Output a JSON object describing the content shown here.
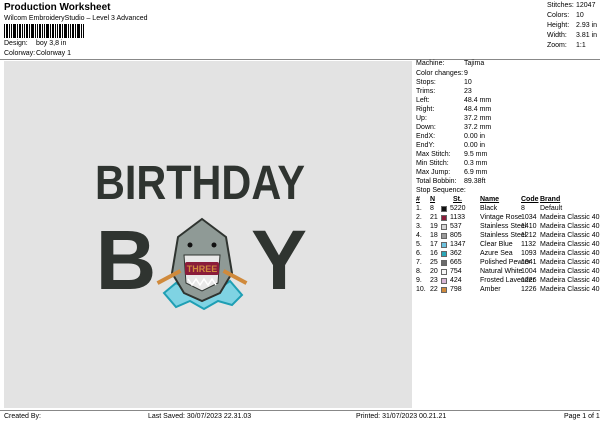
{
  "header": {
    "title": "Production Worksheet",
    "subtitle": "Wilcom EmbroideryStudio – Level 3 Advanced",
    "design_label": "Design:",
    "design_value": "boy 3,8 in",
    "colorway_label": "Colorway:",
    "colorway_value": "Colorway 1"
  },
  "header_stats": [
    {
      "label": "Stitches:",
      "value": "12047"
    },
    {
      "label": "Colors:",
      "value": "10"
    },
    {
      "label": "Height:",
      "value": "2.93 in"
    },
    {
      "label": "Width:",
      "value": "3.81 in"
    },
    {
      "label": "Zoom:",
      "value": "1:1"
    }
  ],
  "design": {
    "line1": "BIRTHDAY",
    "line2_left": "B",
    "line2_right": "Y",
    "three_text": "THREE"
  },
  "machine_info": [
    {
      "label": "Machine:",
      "value": "Tajima"
    },
    {
      "label": "Color changes:",
      "value": "9"
    },
    {
      "label": "Stops:",
      "value": "10"
    },
    {
      "label": "Trims:",
      "value": "23"
    },
    {
      "label": "Left:",
      "value": "48.4 mm"
    },
    {
      "label": "Right:",
      "value": "48.4 mm"
    },
    {
      "label": "Up:",
      "value": "37.2 mm"
    },
    {
      "label": "Down:",
      "value": "37.2 mm"
    },
    {
      "label": "EndX:",
      "value": "0.00 in"
    },
    {
      "label": "EndY:",
      "value": "0.00 in"
    },
    {
      "label": "Max Stitch:",
      "value": "9.5 mm"
    },
    {
      "label": "Min Stitch:",
      "value": "0.3 mm"
    },
    {
      "label": "Max Jump:",
      "value": "6.9 mm"
    },
    {
      "label": "Total Bobbin:",
      "value": "89.38ft"
    }
  ],
  "stop_sequence": {
    "label": "Stop Sequence:",
    "columns": [
      "#",
      "N",
      "St.",
      "Name",
      "Code",
      "Brand"
    ],
    "rows": [
      {
        "num": "1.",
        "n": "8",
        "st": "5220",
        "name": "Black",
        "code": "8",
        "brand": "Default",
        "color": "#111111"
      },
      {
        "num": "2.",
        "n": "21",
        "st": "1133",
        "name": "Vintage Rose",
        "code": "1034",
        "brand": "Madeira Classic 40",
        "color": "#8a1c3a"
      },
      {
        "num": "3.",
        "n": "19",
        "st": "537",
        "name": "Stainless Steel",
        "code": "1410",
        "brand": "Madeira Classic 40",
        "color": "#d4d4d4"
      },
      {
        "num": "4.",
        "n": "18",
        "st": "805",
        "name": "Stainless Steel",
        "code": "1212",
        "brand": "Madeira Classic 40",
        "color": "#9a9a9a"
      },
      {
        "num": "5.",
        "n": "17",
        "st": "1347",
        "name": "Clear Blue",
        "code": "1132",
        "brand": "Madeira Classic 40",
        "color": "#6ec3e0"
      },
      {
        "num": "6.",
        "n": "16",
        "st": "362",
        "name": "Azure Sea",
        "code": "1093",
        "brand": "Madeira Classic 40",
        "color": "#2aa7b8"
      },
      {
        "num": "7.",
        "n": "25",
        "st": "665",
        "name": "Polished Pewter",
        "code": "1041",
        "brand": "Madeira Classic 40",
        "color": "#6b6b6b"
      },
      {
        "num": "8.",
        "n": "20",
        "st": "754",
        "name": "Natural White",
        "code": "1004",
        "brand": "Madeira Classic 40",
        "color": "#f7f7f7"
      },
      {
        "num": "9.",
        "n": "23",
        "st": "424",
        "name": "Frosted Lavender",
        "code": "1226",
        "brand": "Madeira Classic 40",
        "color": "#d9b7d6"
      },
      {
        "num": "10.",
        "n": "22",
        "st": "798",
        "name": "Amber",
        "code": "1226",
        "brand": "Madeira Classic 40",
        "color": "#d08a3c"
      }
    ]
  },
  "footer": {
    "created_by": "Created By:",
    "last_saved": "Last Saved: 30/07/2023 22.31.03",
    "printed": "Printed: 31/07/2023 00.21.21",
    "page": "Page 1 of 1"
  }
}
